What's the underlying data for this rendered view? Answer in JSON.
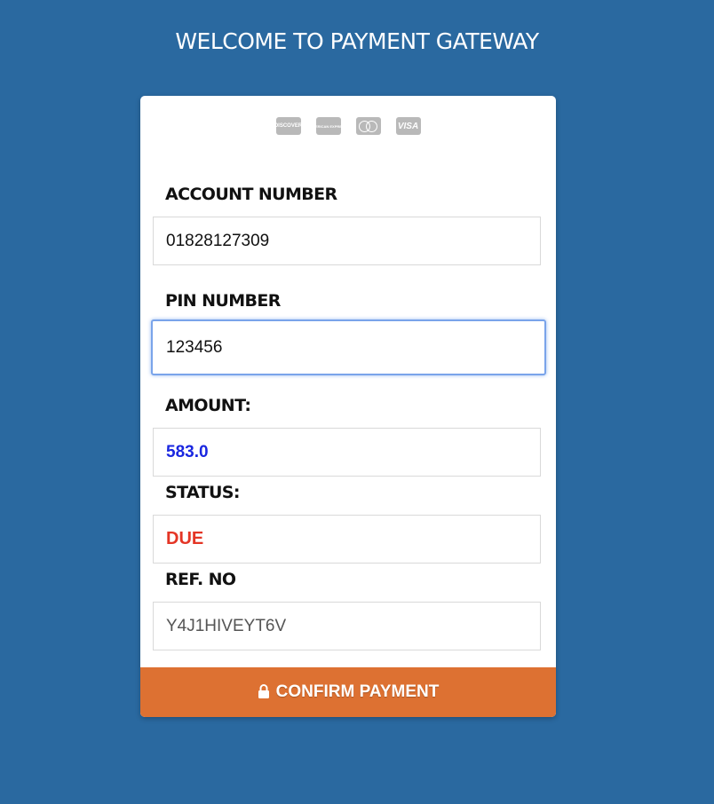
{
  "header": {
    "title": "WELCOME TO PAYMENT GATEWAY"
  },
  "card_logos": [
    {
      "name": "discover-logo-icon",
      "label": "DISCOVER"
    },
    {
      "name": "amex-logo-icon",
      "label": "AMERICAN EXPRESS"
    },
    {
      "name": "mastercard-logo-icon",
      "label": ""
    },
    {
      "name": "visa-logo-icon",
      "label": "VISA"
    }
  ],
  "form": {
    "account_number": {
      "label": "ACCOUNT NUMBER",
      "value": "01828127309"
    },
    "pin_number": {
      "label": "PIN NUMBER",
      "value": "123456"
    },
    "amount": {
      "label": "AMOUNT:",
      "value": "583.0"
    },
    "status": {
      "label": "STATUS:",
      "value": "DUE"
    },
    "ref_no": {
      "label": "REF. NO",
      "value": "Y4J1HIVEYT6V"
    }
  },
  "confirm_button": {
    "label": "CONFIRM PAYMENT",
    "icon": "lock-icon"
  },
  "colors": {
    "background": "#2a69a0",
    "button": "#dd7132",
    "amount": "#1a27e0",
    "status": "#e43525"
  }
}
